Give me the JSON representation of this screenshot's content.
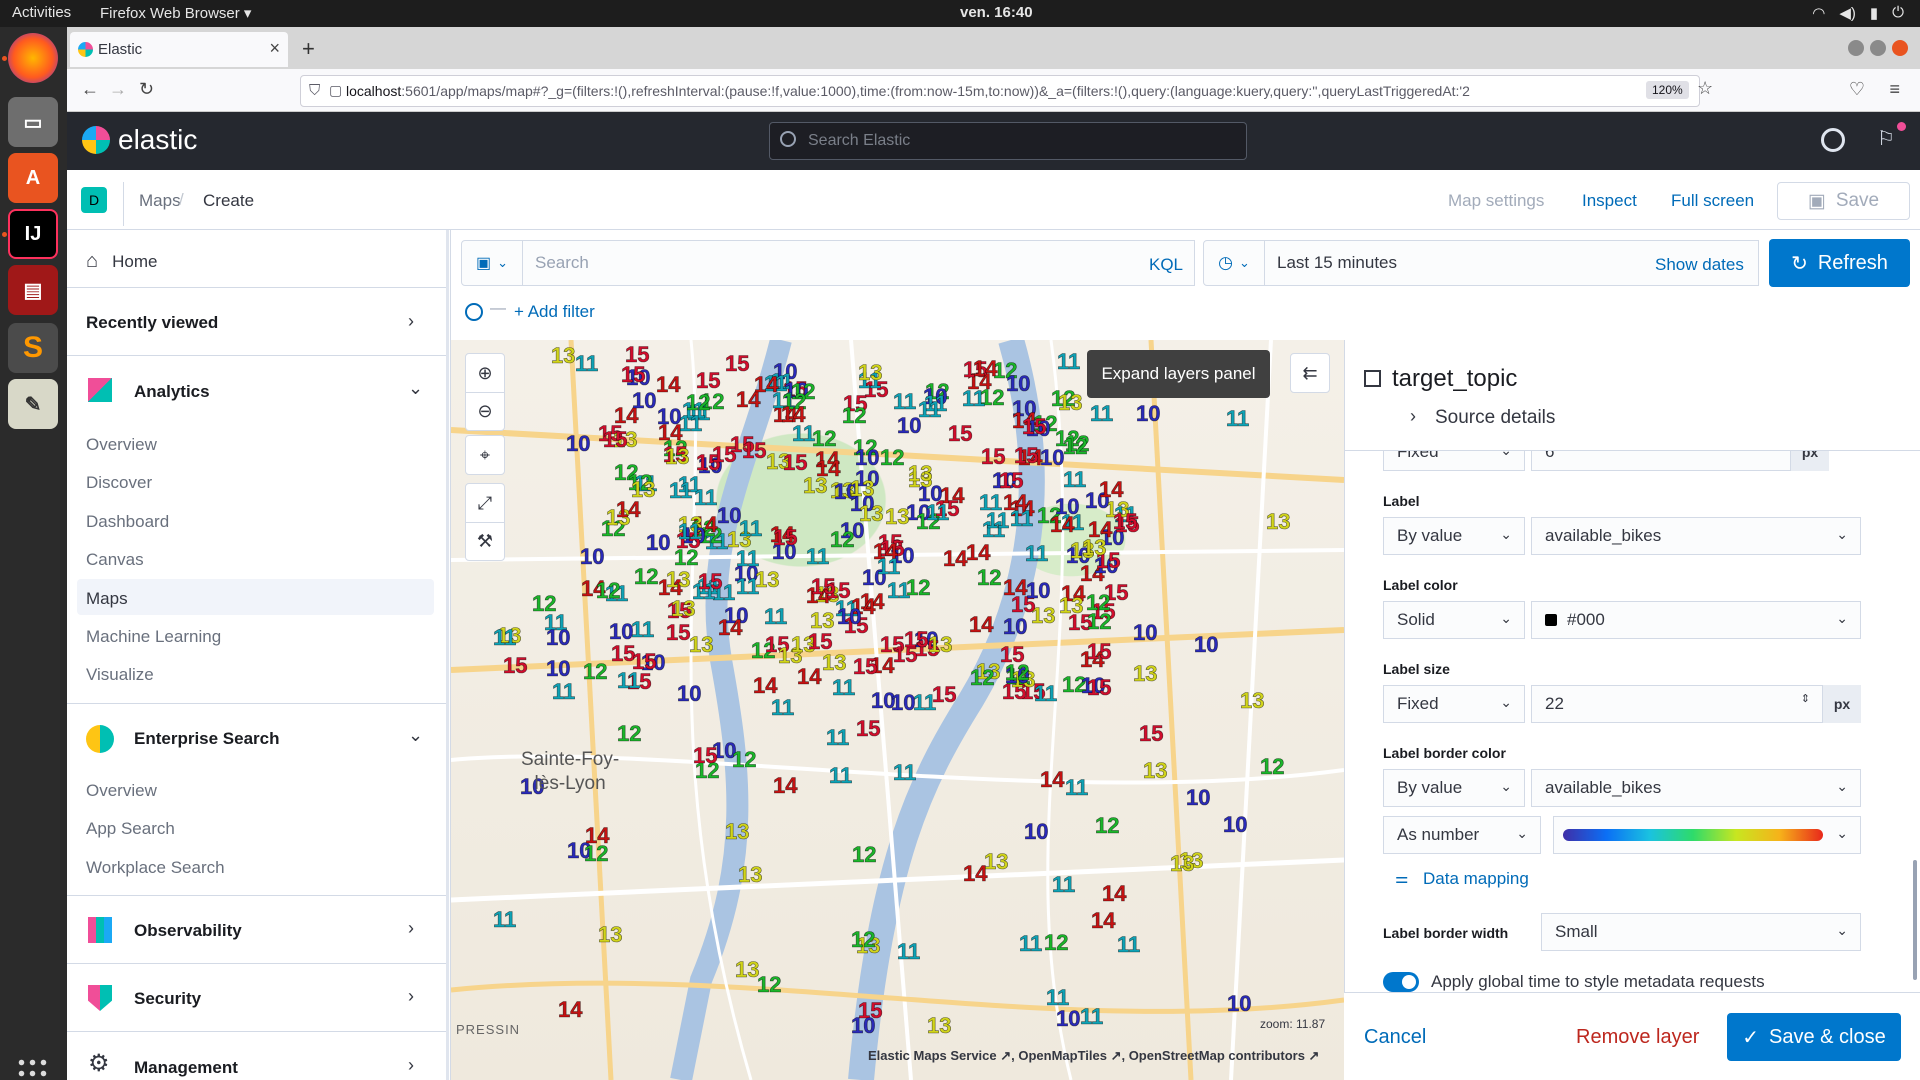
{
  "system": {
    "activities": "Activities",
    "app_menu": "Firefox Web Browser ▾",
    "clock": "ven. 16:40"
  },
  "browser": {
    "tab_title": "Elastic",
    "url_host": "localhost",
    "url_rest": ":5601/app/maps/map#?_g=(filters:!(),refreshInterval:(pause:!f,value:1000),time:(from:now-15m,to:now))&_a=(filters:!(),query:(language:kuery,query:'',queryLastTriggeredAt:'2",
    "zoom": "120%"
  },
  "kibana": {
    "brand": "elastic",
    "search_placeholder": "Search Elastic",
    "space_initial": "D",
    "breadcrumbs": [
      "Maps",
      "Create"
    ],
    "top_links": {
      "map_settings": "Map settings",
      "inspect": "Inspect",
      "full_screen": "Full screen",
      "save": "Save"
    }
  },
  "sidenav": {
    "home": "Home",
    "recently_viewed": "Recently viewed",
    "analytics": {
      "title": "Analytics",
      "items": [
        "Overview",
        "Discover",
        "Dashboard",
        "Canvas",
        "Maps",
        "Machine Learning",
        "Visualize"
      ],
      "active": "Maps"
    },
    "enterprise": {
      "title": "Enterprise Search",
      "items": [
        "Overview",
        "App Search",
        "Workplace Search"
      ]
    },
    "observability": "Observability",
    "security": "Security",
    "management": "Management"
  },
  "querybar": {
    "search_placeholder": "Search",
    "kql": "KQL",
    "time_range": "Last 15 minutes",
    "show_dates": "Show dates",
    "refresh": "Refresh",
    "add_filter": "+ Add filter"
  },
  "map": {
    "tooltip": "Expand layers panel",
    "place_label": "Sainte-Foy-\nlès-Lyon",
    "district_label": "PRESSIN",
    "zoom_text": "zoom: 11.87",
    "attribution": "Elastic Maps Service ↗, OpenMapTiles ↗, OpenStreetMap contributors ↗",
    "colors": {
      "10": "#2a2ab8",
      "11": "#0fa2b5",
      "12": "#1bb52a",
      "13": "#d1d41b",
      "14": "#c41212",
      "15": "#d10d2c"
    },
    "visible_label_values": [
      10,
      11,
      12,
      13,
      14,
      15
    ]
  },
  "editor": {
    "layer_name": "target_topic",
    "source_details": "Source details",
    "partial_row": {
      "select": "Fixed",
      "value": "6",
      "unit": "px"
    },
    "label": {
      "title": "Label",
      "mode": "By value",
      "field": "available_bikes"
    },
    "label_color": {
      "title": "Label color",
      "mode": "Solid",
      "value": "#000"
    },
    "label_size": {
      "title": "Label size",
      "mode": "Fixed",
      "value": "22",
      "unit": "px"
    },
    "label_border_color": {
      "title": "Label border color",
      "mode": "By value",
      "field": "available_bikes",
      "as": "As number"
    },
    "data_mapping": "Data mapping",
    "label_border_width": {
      "title": "Label border width",
      "value": "Small"
    },
    "apply_time": "Apply global time to style metadata requests",
    "cancel": "Cancel",
    "remove": "Remove layer",
    "save_close": "Save & close"
  }
}
